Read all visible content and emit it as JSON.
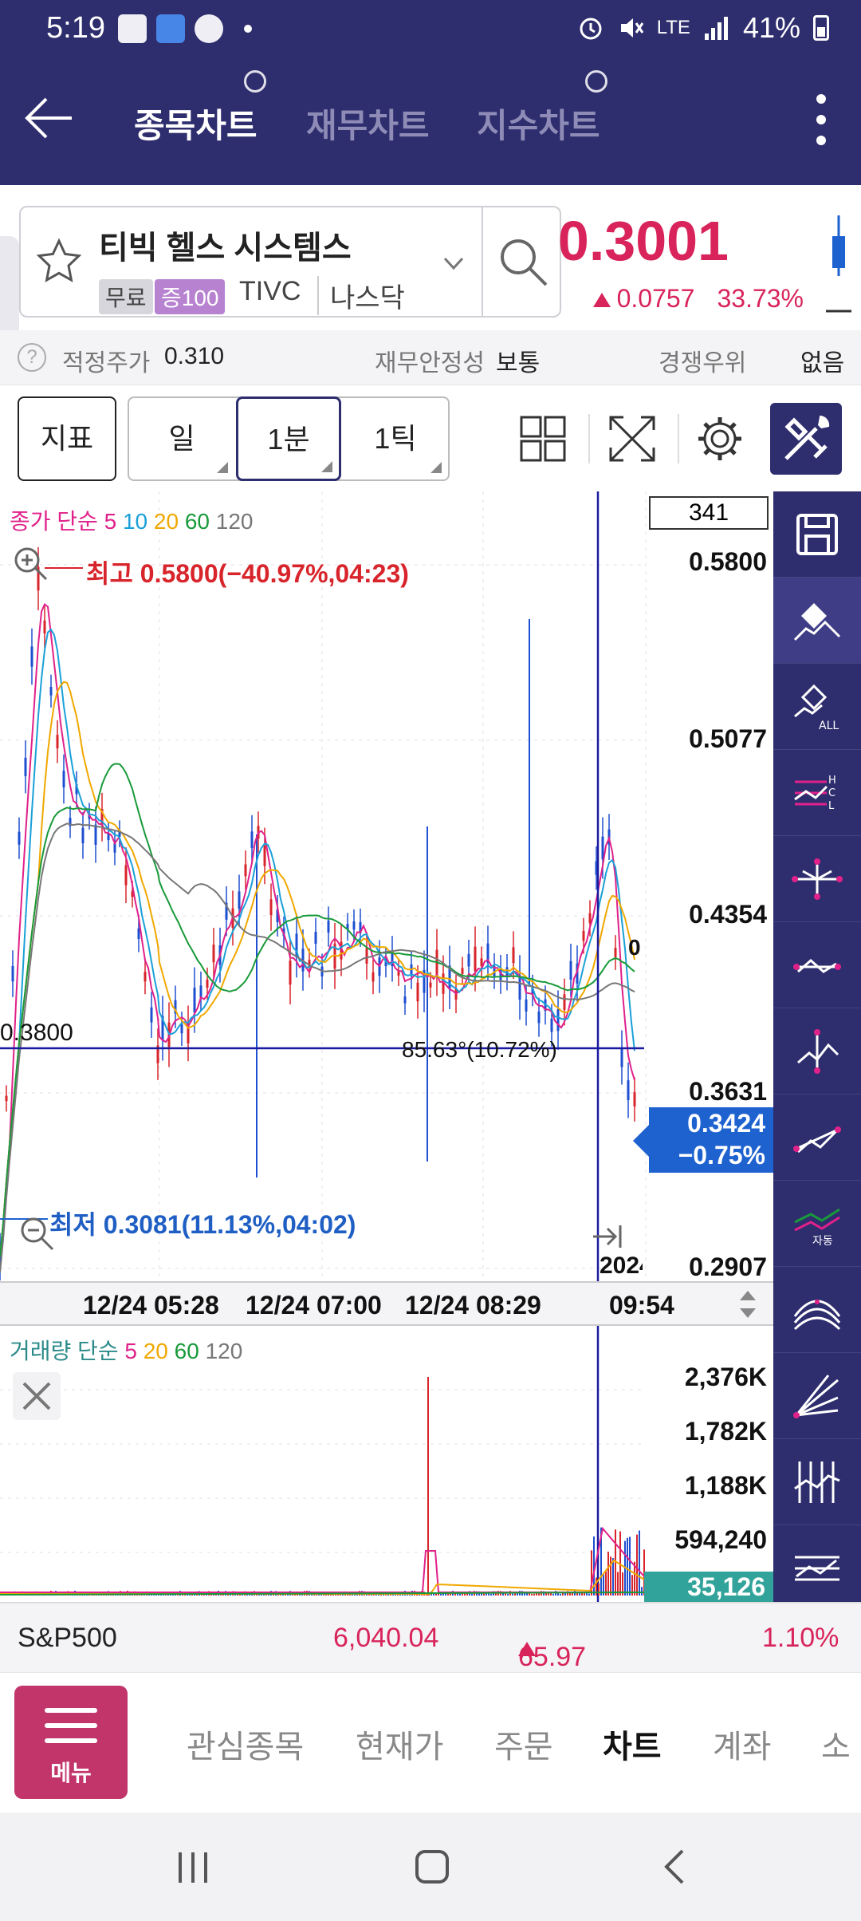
{
  "status": {
    "time": "5:19",
    "battery": "41%",
    "network": "LTE"
  },
  "app_bar": {
    "tabs": [
      {
        "label": "종목차트",
        "active": true
      },
      {
        "label": "재무차트",
        "active": false
      },
      {
        "label": "지수차트",
        "active": false
      }
    ]
  },
  "stock": {
    "name": "티빅 헬스 시스템스",
    "tag_free": "무료",
    "tag_margin": "증100",
    "ticker": "TIVC",
    "market": "나스닥",
    "price": "0.3001",
    "change": "0.0757",
    "change_pct": "33.73%",
    "color_up": "#d8245b"
  },
  "info": {
    "fair_price_label": "적정주가",
    "fair_price": "0.310",
    "stability_label": "재무안정성",
    "stability": "보통",
    "competitive_label": "경쟁우위",
    "competitive": "없음"
  },
  "toolbar": {
    "indicator": "지표",
    "periods": [
      "일",
      "1분",
      "1틱"
    ],
    "selected_period": "1분"
  },
  "chart": {
    "legend_prefix": "종가 단순",
    "legend_ma": [
      {
        "label": "5",
        "color": "#e0218a"
      },
      {
        "label": "10",
        "color": "#1aa0d8"
      },
      {
        "label": "20",
        "color": "#f0a800"
      },
      {
        "label": "60",
        "color": "#199a3a"
      },
      {
        "label": "120",
        "color": "#777777"
      }
    ],
    "y_labels": [
      "0.5800",
      "0.5077",
      "0.4354",
      "0.3631",
      "0.2907"
    ],
    "high_label": "최고 0.5800(−40.97%,04:23)",
    "low_label": "최저 0.3081(11.13%,04:02)",
    "hline_label": "0.3800",
    "angle_label": "85.63°(10.72%)",
    "current_price": "0.3424",
    "current_pct": "−0.75%",
    "box_value": "341",
    "zero_label": "0",
    "axis_year": "2024",
    "time_labels": [
      "12/24 05:28",
      "12/24 07:00",
      "12/24 08:29",
      "09:54"
    ]
  },
  "volume": {
    "legend_prefix": "거래량 단순",
    "legend_ma": [
      {
        "label": "5",
        "color": "#e0218a"
      },
      {
        "label": "20",
        "color": "#f0a800"
      },
      {
        "label": "60",
        "color": "#199a3a"
      },
      {
        "label": "120",
        "color": "#777777"
      }
    ],
    "y_labels": [
      "2,376K",
      "1,782K",
      "1,188K",
      "594,240"
    ],
    "current": "35,126"
  },
  "sidebar_tools": [
    "save-icon",
    "eraser-icon",
    "eraser-all-icon",
    "hcl-line-icon",
    "crosshair-icon",
    "trendline-icon",
    "vertex-icon",
    "line-icon",
    "auto-trend-icon",
    "fan-icon",
    "fib-fan-icon",
    "vertical-lines-icon",
    "channel-icon"
  ],
  "index_bar": {
    "name": "S&P500",
    "value": "6,040.04",
    "change": "65.97",
    "change_pct": "1.10%"
  },
  "bottom_nav": {
    "menu": "메뉴",
    "items": [
      {
        "label": "관심종목",
        "active": false
      },
      {
        "label": "현재가",
        "active": false
      },
      {
        "label": "주문",
        "active": false
      },
      {
        "label": "차트",
        "active": true
      },
      {
        "label": "계좌",
        "active": false
      },
      {
        "label": "소",
        "active": false
      }
    ]
  }
}
